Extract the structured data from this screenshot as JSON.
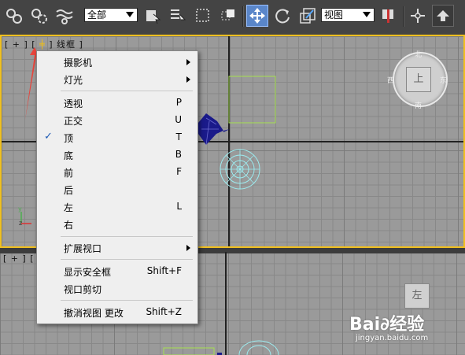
{
  "toolbar": {
    "select_filter": "全部",
    "refcoord": "视图"
  },
  "top_viewport": {
    "label_prefix": "[ + ]",
    "label_pov": "[",
    "label_shading": "] 线框 ]"
  },
  "bottom_viewport": {
    "label_prefix": "[ + ]",
    "label_pov": "[",
    "cube_face": "左"
  },
  "viewcube": {
    "face": "上",
    "north": "北",
    "south": "南",
    "east": "东",
    "west": "西"
  },
  "context_menu": {
    "items": [
      {
        "label": "摄影机",
        "shortcut": "",
        "submenu": true
      },
      {
        "label": "灯光",
        "shortcut": "",
        "submenu": true
      },
      {
        "label": "透视",
        "shortcut": "P"
      },
      {
        "label": "正交",
        "shortcut": "U"
      },
      {
        "label": "顶",
        "shortcut": "T",
        "checked": true
      },
      {
        "label": "底",
        "shortcut": "B"
      },
      {
        "label": "前",
        "shortcut": "F"
      },
      {
        "label": "后",
        "shortcut": ""
      },
      {
        "label": "左",
        "shortcut": "L"
      },
      {
        "label": "右",
        "shortcut": ""
      },
      {
        "label": "扩展视口",
        "shortcut": "",
        "submenu": true
      },
      {
        "label": "显示安全框",
        "shortcut": "Shift+F"
      },
      {
        "label": "视口剪切",
        "shortcut": ""
      },
      {
        "label": "撤消视图 更改",
        "shortcut": "Shift+Z"
      }
    ],
    "check_mark": "✓"
  },
  "watermark": {
    "brand": "Bai∂经验",
    "url": "jingyan.baidu.com"
  },
  "colors": {
    "active_border": "#f0c020",
    "annotation_arrow": "#e8453c"
  }
}
